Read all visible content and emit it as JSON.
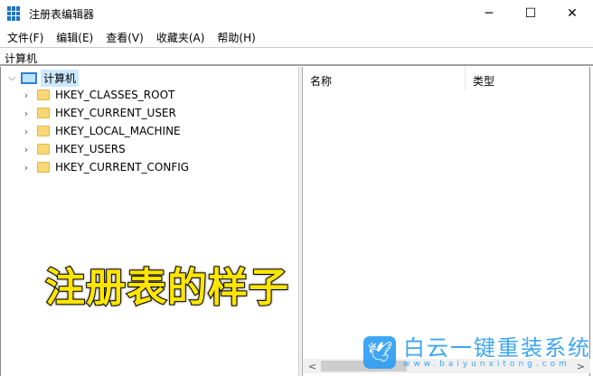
{
  "window": {
    "title": "注册表编辑器",
    "minimize": "─",
    "maximize": "☐",
    "close": "✕"
  },
  "menu": [
    "文件(F)",
    "编辑(E)",
    "查看(V)",
    "收藏夹(A)",
    "帮助(H)"
  ],
  "address": "计算机",
  "tree": {
    "root": "计算机",
    "children": [
      "HKEY_CLASSES_ROOT",
      "HKEY_CURRENT_USER",
      "HKEY_LOCAL_MACHINE",
      "HKEY_USERS",
      "HKEY_CURRENT_CONFIG"
    ]
  },
  "columns": [
    "名称",
    "类型"
  ],
  "overlay_caption": "注册表的样子",
  "watermark": {
    "name": "白云一键重装系统",
    "url": "www.baiyunxitong.com"
  },
  "scroll": {
    "left": "<",
    "right": ">"
  }
}
